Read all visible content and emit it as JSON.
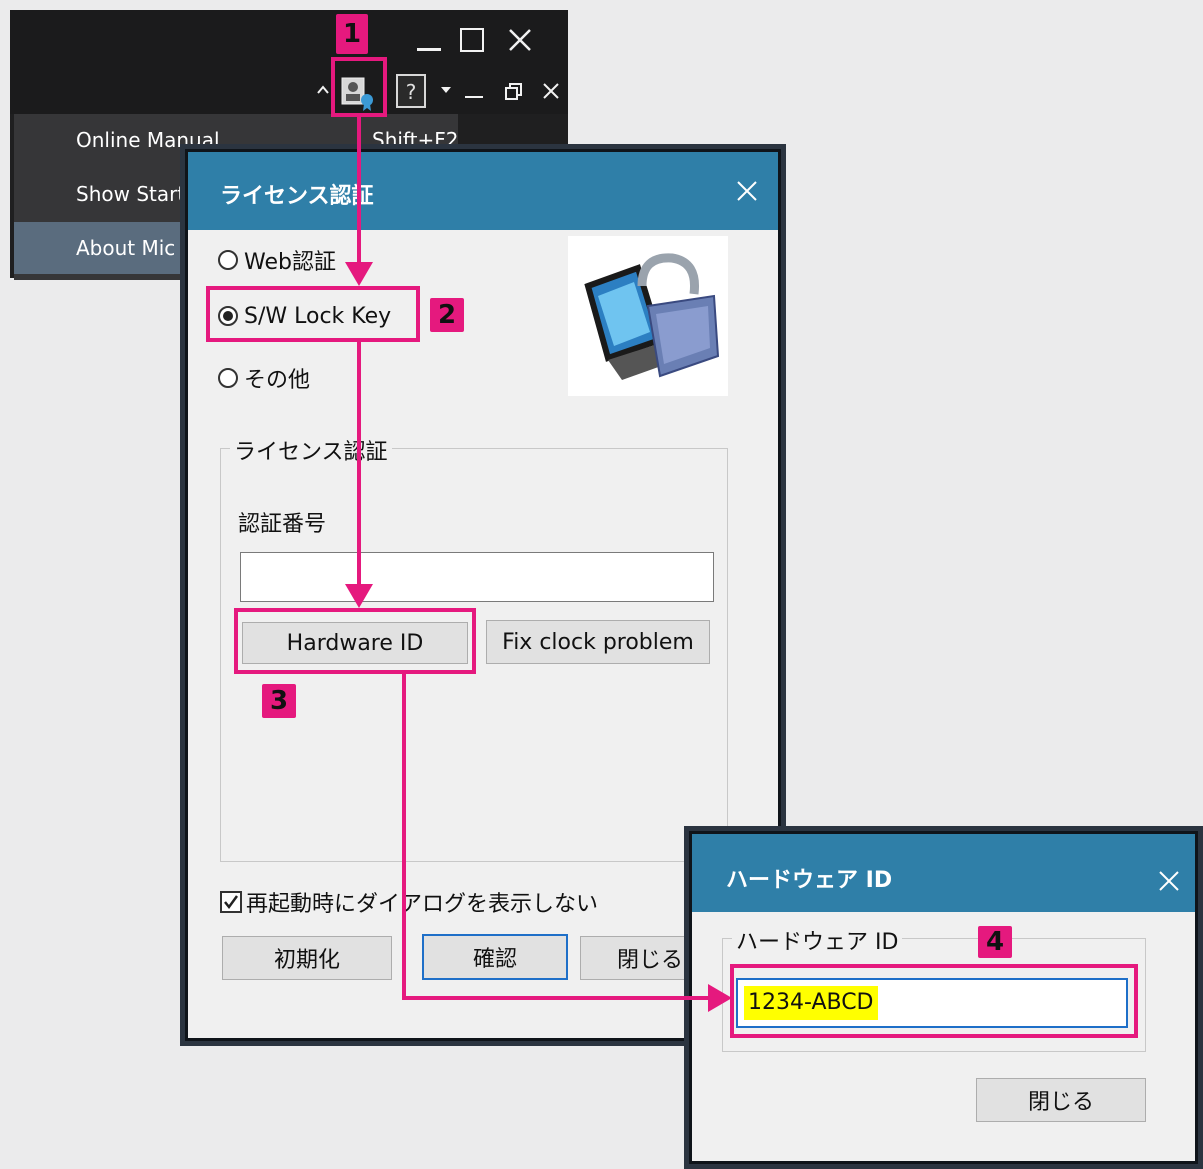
{
  "app": {
    "menu": [
      {
        "label": "Online Manual",
        "shortcut": "Shift+F2"
      },
      {
        "label": "Show Start"
      },
      {
        "label": "About Mic"
      }
    ]
  },
  "license_dialog": {
    "title": "ライセンス認証",
    "options": [
      {
        "label": "Web認証",
        "selected": false
      },
      {
        "label": "S/W Lock Key",
        "selected": true
      },
      {
        "label": "その他",
        "selected": false
      }
    ],
    "group_title": "ライセンス認証",
    "auth_number_label": "認証番号",
    "auth_number_value": "",
    "hardware_id_button": "Hardware ID",
    "fix_clock_button": "Fix clock problem",
    "dont_show_label": "再起動時にダイアログを表示しない",
    "dont_show_checked": true,
    "init_button": "初期化",
    "confirm_button": "確認",
    "close_button": "閉じる"
  },
  "hwid_dialog": {
    "title": "ハードウェア ID",
    "group_title": "ハードウェア ID",
    "value": "1234-ABCD",
    "close_button": "閉じる"
  },
  "callouts": [
    "1",
    "2",
    "3",
    "4"
  ],
  "colors": {
    "accent": "#e5197e",
    "titlebar": "#2f7fa8",
    "highlight": "#ffff00"
  }
}
